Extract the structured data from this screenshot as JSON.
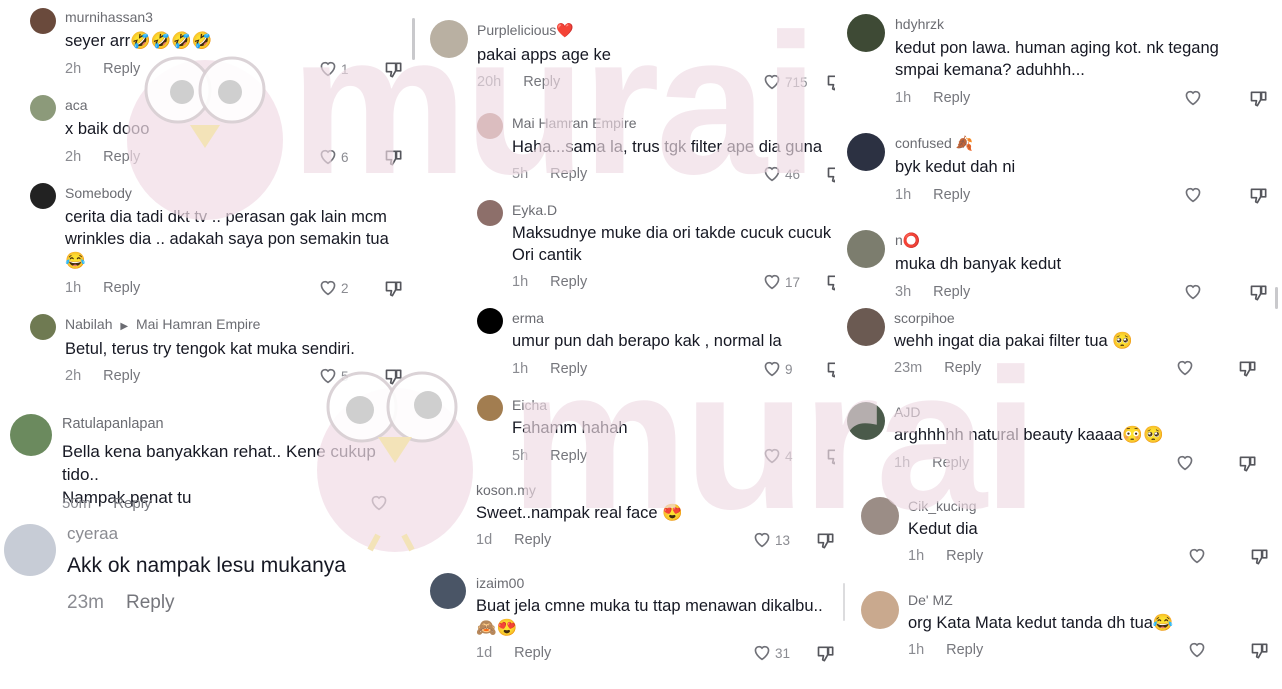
{
  "watermark": {
    "text": "murai",
    "color": "#efdbe4"
  },
  "columns": [
    {
      "comments": [
        {
          "username": "murnihassan3",
          "text": "seyer arr🤣🤣🤣🤣",
          "time": "2h",
          "reply": "Reply",
          "likes": "1",
          "avatar_color": "#6a4a3c"
        },
        {
          "username": "aca",
          "text": "x baik dooo",
          "time": "2h",
          "reply": "Reply",
          "likes": "6",
          "avatar_color": "#8c9a7a"
        },
        {
          "username": "Somebody",
          "text": "cerita dia tadi dkt tv .. perasan gak lain mcm\nwrinkles dia .. adakah saya pon semakin tua\n😂",
          "time": "1h",
          "reply": "Reply",
          "likes": "2",
          "avatar_color": "#222222"
        },
        {
          "username": "Nabilah",
          "reply_to": "Mai Hamran Empire",
          "text": "Betul, terus try tengok kat muka sendiri.",
          "time": "2h",
          "reply": "Reply",
          "likes": "5",
          "avatar_color": "#6f7a52"
        },
        {
          "username": "Ratulapanlapan",
          "text": "Bella kena banyakkan rehat.. Kene cukup tido..\nNampak penat tu",
          "time": "50m",
          "reply": "Reply",
          "likes": "",
          "avatar_color": "#6b8a5e"
        },
        {
          "username": "cyeraa",
          "text": "Akk ok nampak lesu mukanya",
          "time": "23m",
          "reply": "Reply",
          "avatar_color": "#c7ccd6"
        }
      ]
    },
    {
      "comments": [
        {
          "username": "Purplelicious❤️",
          "text": "pakai apps age ke",
          "time": "20h",
          "reply": "Reply",
          "likes": "715",
          "avatar_color": "#b9b0a2"
        },
        {
          "username": "Mai Hamran Empire",
          "text": "Haha...sama la, trus tgk filter ape dia guna",
          "time": "5h",
          "reply": "Reply",
          "likes": "46",
          "avatar_color": "#b6857c"
        },
        {
          "username": "Eyka.D",
          "text": "Maksudnye muke dia ori takde cucuk cucuk\nOri cantik",
          "time": "1h",
          "reply": "Reply",
          "likes": "17",
          "avatar_color": "#8d6f6a"
        },
        {
          "username": "erma",
          "text": "umur pun dah berapo kak , normal la",
          "time": "1h",
          "reply": "Reply",
          "likes": "9",
          "avatar_color": "#000000"
        },
        {
          "username": "Eicha",
          "text": "Fahamm hahah",
          "time": "5h",
          "reply": "Reply",
          "likes": "4",
          "avatar_color": "#a27d50"
        },
        {
          "username": "koson.my",
          "text": "Sweet..nampak real face 😍",
          "time": "1d",
          "reply": "Reply",
          "likes": "13"
        },
        {
          "username": "izaim00",
          "text": "Buat jela cmne muka tu ttap menawan dikalbu..\n🙈😍",
          "time": "1d",
          "reply": "Reply",
          "likes": "31",
          "avatar_color": "#4a5566"
        }
      ]
    },
    {
      "comments": [
        {
          "username": "hdyhrzk",
          "text": "kedut pon lawa. human aging kot. nk tegang\nsmpai kemana? aduhhh...",
          "time": "1h",
          "reply": "Reply",
          "avatar_color": "#3e4a35"
        },
        {
          "username": "confused 🍂",
          "text": "byk kedut dah ni",
          "time": "1h",
          "reply": "Reply",
          "avatar_color": "#2c3142"
        },
        {
          "username": "n⭕",
          "text": "muka dh banyak kedut",
          "time": "3h",
          "reply": "Reply",
          "avatar_color": "#7c7d6e"
        },
        {
          "username": "scorpihoe",
          "text": "wehh ingat dia pakai filter tua 🥺",
          "time": "23m",
          "reply": "Reply",
          "avatar_color": "#6b5a52"
        },
        {
          "username": "AJD",
          "text": "arghhhhh natural beauty kaaaa😳🥺",
          "time": "1h",
          "reply": "Reply",
          "avatar_color": "#4a5a4a"
        },
        {
          "username": "Cik_kucing",
          "text": "Kedut dia",
          "time": "1h",
          "reply": "Reply",
          "avatar_color": "#9b8d86"
        },
        {
          "username": "De' MZ",
          "text": "org Kata Mata kedut tanda dh tua😂",
          "time": "1h",
          "reply": "Reply",
          "avatar_color": "#c9a98e"
        }
      ]
    }
  ]
}
